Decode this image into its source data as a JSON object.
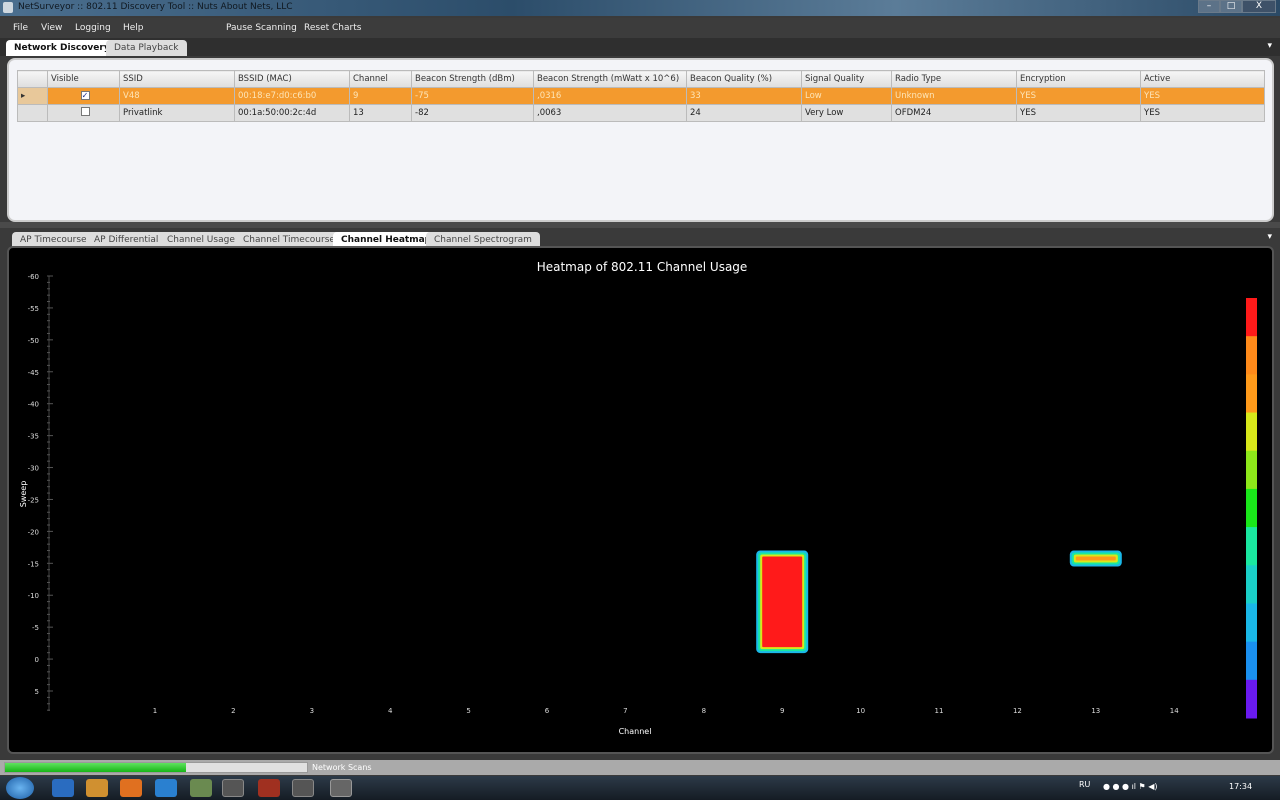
{
  "window": {
    "title": "NetSurveyor :: 802.11 Discovery Tool :: Nuts About Nets, LLC",
    "min": "–",
    "max": "□",
    "close": "X"
  },
  "menu": [
    "File",
    "View",
    "Logging",
    "Help"
  ],
  "toolbar": {
    "pause": "Pause Scanning",
    "reset": "Reset Charts"
  },
  "top_tabs": [
    "Network Discovery",
    "Data Playback"
  ],
  "table": {
    "columns": [
      "Visible",
      "SSID",
      "BSSID (MAC)",
      "Channel",
      "Beacon Strength (dBm)",
      "Beacon Strength (mWatt x 10^6)",
      "Beacon Quality (%)",
      "Signal Quality",
      "Radio Type",
      "Encryption",
      "Active"
    ],
    "rows": [
      {
        "visible": true,
        "cells": [
          "V48",
          "00:18:e7:d0:c6:b0",
          "9",
          "-75",
          ",0316",
          "33",
          "Low",
          "Unknown",
          "YES",
          "YES"
        ]
      },
      {
        "visible": false,
        "cells": [
          "Privatlink",
          "00:1a:50:00:2c:4d",
          "13",
          "-82",
          ",0063",
          "24",
          "Very Low",
          "OFDM24",
          "YES",
          "YES"
        ]
      }
    ]
  },
  "chart_tabs": [
    "AP Timecourse",
    "AP Differential",
    "Channel Usage",
    "Channel Timecourse",
    "Channel Heatmap",
    "Channel Spectrogram"
  ],
  "active_chart_tab": "Channel Heatmap",
  "chart_data": {
    "type": "heatmap",
    "title": "Heatmap of 802.11 Channel Usage",
    "xlabel": "Channel",
    "ylabel": "Sweep",
    "x_ticks": [
      1,
      2,
      3,
      4,
      5,
      6,
      7,
      8,
      9,
      10,
      11,
      12,
      13,
      14
    ],
    "y_ticks": [
      -60,
      -55,
      -50,
      -45,
      -40,
      -35,
      -30,
      -25,
      -20,
      -15,
      -10,
      -5,
      0,
      5
    ],
    "ylim": [
      5,
      -60
    ],
    "cells": [
      {
        "channel": 9,
        "sweep_from": 0,
        "sweep_to": -17,
        "level": "high",
        "color": "#ff1a1a"
      },
      {
        "channel": 13,
        "sweep_from": -14.5,
        "sweep_to": -17,
        "level": "medium",
        "color": "#ff9a1a"
      }
    ],
    "color_scale": [
      "#ff1a1a",
      "#ff8a1a",
      "#ff9a1a",
      "#d8e81a",
      "#8ee81a",
      "#1ae81a",
      "#1ae8a0",
      "#1ad0c8",
      "#1ab8e8",
      "#1a90f0",
      "#6a1af0"
    ]
  },
  "status": {
    "label": "Network Scans",
    "progress": 0.6
  },
  "tray": {
    "lang": "RU",
    "time": "17:34"
  }
}
